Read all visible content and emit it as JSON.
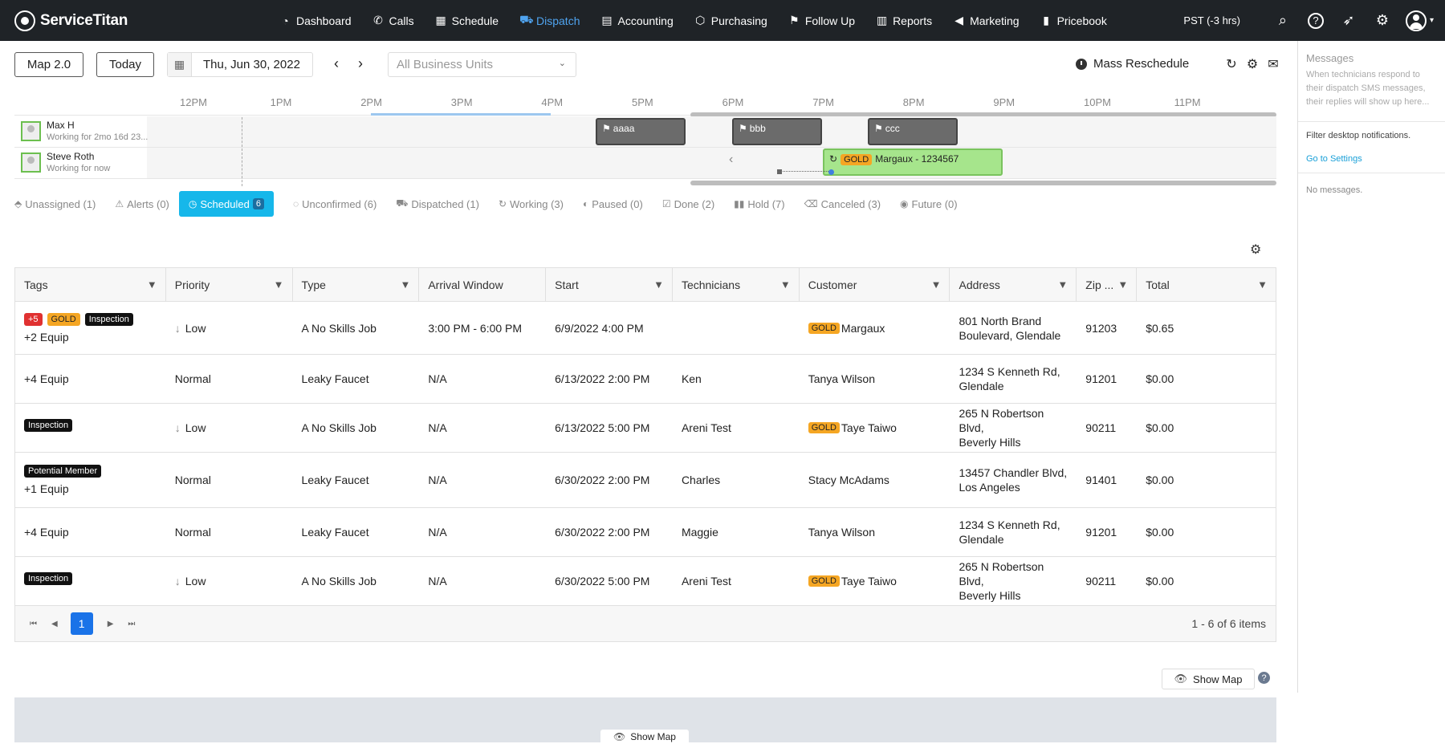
{
  "nav": {
    "brand": "ServiceTitan",
    "items": [
      {
        "label": "Dashboard",
        "icon": "dashboard-icon",
        "glyph": "◔",
        "active": false
      },
      {
        "label": "Calls",
        "icon": "phone-icon",
        "glyph": "✆",
        "active": false
      },
      {
        "label": "Schedule",
        "icon": "calendar-icon",
        "glyph": "▦",
        "active": false
      },
      {
        "label": "Dispatch",
        "icon": "truck-icon",
        "glyph": "⛟",
        "active": true
      },
      {
        "label": "Accounting",
        "icon": "clipboard-icon",
        "glyph": "▤",
        "active": false
      },
      {
        "label": "Purchasing",
        "icon": "box-icon",
        "glyph": "⬡",
        "active": false
      },
      {
        "label": "Follow Up",
        "icon": "flag-icon",
        "glyph": "⚑",
        "active": false
      },
      {
        "label": "Reports",
        "icon": "chart-icon",
        "glyph": "▥",
        "active": false
      },
      {
        "label": "Marketing",
        "icon": "megaphone-icon",
        "glyph": "◀",
        "active": false
      },
      {
        "label": "Pricebook",
        "icon": "book-icon",
        "glyph": "▮",
        "active": false
      }
    ],
    "timezone": "PST (-3 hrs)",
    "right_icons": {
      "search": "⌕",
      "help": "?",
      "rocket": "➶",
      "settings": "⚙",
      "caret": "▾"
    }
  },
  "toolbar": {
    "map_button": "Map 2.0",
    "today_button": "Today",
    "date": "Thu, Jun 30, 2022",
    "calendar_glyph": "▦",
    "prev_glyph": "‹",
    "next_glyph": "›",
    "business_units_placeholder": "All Business Units",
    "dropdown_glyph": "⌄",
    "mass_reschedule": "Mass Reschedule",
    "refresh_glyph": "↻",
    "gear_glyph": "⚙",
    "mail_glyph": "✉"
  },
  "timeline": {
    "hours": [
      "12PM",
      "1PM",
      "2PM",
      "3PM",
      "4PM",
      "5PM",
      "6PM",
      "7PM",
      "8PM",
      "9PM",
      "10PM",
      "11PM"
    ],
    "technicians": [
      {
        "name": "Max H",
        "status": "Working for 2mo 16d 23..."
      },
      {
        "name": "Steve Roth",
        "status": "Working for now"
      }
    ],
    "appointments": [
      {
        "tech": 0,
        "label": "aaaa",
        "flag": "⚑"
      },
      {
        "tech": 0,
        "label": "bbb",
        "flag": "⚑"
      },
      {
        "tech": 0,
        "label": "ccc",
        "flag": "⚑"
      },
      {
        "tech": 1,
        "label": "Margaux - 1234567",
        "badge": "GOLD",
        "glyph": "↻"
      }
    ],
    "lane_back_glyph": "‹"
  },
  "tabs": [
    {
      "label": "Unassigned (1)",
      "icon": "tag-icon",
      "glyph": "⬘"
    },
    {
      "label": "Alerts (0)",
      "icon": "warning-icon",
      "glyph": "⚠"
    },
    {
      "label": "Scheduled",
      "count": "6",
      "icon": "clock-icon",
      "glyph": "◷",
      "active": true
    },
    {
      "label": "Unconfirmed (6)",
      "icon": "check-circle-icon",
      "glyph": "◌"
    },
    {
      "label": "Dispatched (1)",
      "icon": "truck-icon",
      "glyph": "⛟"
    },
    {
      "label": "Working (3)",
      "icon": "refresh-icon",
      "glyph": "↻"
    },
    {
      "label": "Paused (0)",
      "icon": "half-circle-icon",
      "glyph": "◐"
    },
    {
      "label": "Done (2)",
      "icon": "checkbox-icon",
      "glyph": "☑"
    },
    {
      "label": "Hold (7)",
      "icon": "pause-icon",
      "glyph": "▮▮"
    },
    {
      "label": "Canceled (3)",
      "icon": "trash-icon",
      "glyph": "⌫"
    },
    {
      "label": "Future (0)",
      "icon": "eye-icon",
      "glyph": "◉"
    }
  ],
  "table": {
    "gear_glyph": "⚙",
    "filter_glyph": "▼",
    "columns": [
      "Tags",
      "Priority",
      "Type",
      "Arrival Window",
      "Start",
      "Technicians",
      "Customer",
      "Address",
      "Zip ...",
      "Total"
    ],
    "rows": [
      {
        "tags": [
          {
            "text": "+5",
            "kind": "red"
          },
          {
            "text": "GOLD",
            "kind": "gold"
          },
          {
            "text": "Inspection",
            "kind": "black"
          }
        ],
        "extra": "+2 Equip",
        "priority": "Low",
        "low": true,
        "type": "A No Skills Job",
        "arrival": "3:00 PM - 6:00 PM",
        "start": "6/9/2022 4:00 PM",
        "tech": "",
        "gold": true,
        "customer": "Margaux",
        "address1": "801 North Brand",
        "address2": "Boulevard, Glendale",
        "zip": "91203",
        "total": "$0.65"
      },
      {
        "tags": [],
        "extra": "+4 Equip",
        "priority": "Normal",
        "low": false,
        "type": "Leaky Faucet",
        "arrival": "N/A",
        "start": "6/13/2022 2:00 PM",
        "tech": "Ken",
        "gold": false,
        "customer": "Tanya Wilson",
        "address1": "1234 S Kenneth Rd,",
        "address2": "Glendale",
        "zip": "91201",
        "total": "$0.00"
      },
      {
        "tags": [
          {
            "text": "Inspection",
            "kind": "black"
          }
        ],
        "extra": "",
        "priority": "Low",
        "low": true,
        "type": "A No Skills Job",
        "arrival": "N/A",
        "start": "6/13/2022 5:00 PM",
        "tech": "Areni Test",
        "gold": true,
        "customer": "Taye Taiwo",
        "address1": "265 N Robertson Blvd,",
        "address2": "Beverly Hills",
        "zip": "90211",
        "total": "$0.00"
      },
      {
        "tags": [
          {
            "text": "Potential Member",
            "kind": "black"
          }
        ],
        "extra": "+1 Equip",
        "priority": "Normal",
        "low": false,
        "type": "Leaky Faucet",
        "arrival": "N/A",
        "start": "6/30/2022 2:00 PM",
        "tech": "Charles",
        "gold": false,
        "customer": "Stacy McAdams",
        "address1": "13457 Chandler Blvd,",
        "address2": "Los Angeles",
        "zip": "91401",
        "total": "$0.00"
      },
      {
        "tags": [],
        "extra": "+4 Equip",
        "priority": "Normal",
        "low": false,
        "type": "Leaky Faucet",
        "arrival": "N/A",
        "start": "6/30/2022 2:00 PM",
        "tech": "Maggie",
        "gold": false,
        "customer": "Tanya Wilson",
        "address1": "1234 S Kenneth Rd,",
        "address2": "Glendale",
        "zip": "91201",
        "total": "$0.00"
      },
      {
        "tags": [
          {
            "text": "Inspection",
            "kind": "black"
          }
        ],
        "extra": "",
        "priority": "Low",
        "low": true,
        "type": "A No Skills Job",
        "arrival": "N/A",
        "start": "6/30/2022 5:00 PM",
        "tech": "Areni Test",
        "gold": true,
        "customer": "Taye Taiwo",
        "address1": "265 N Robertson Blvd,",
        "address2": "Beverly Hills",
        "zip": "90211",
        "total": "$0.00"
      }
    ],
    "gold_label": "GOLD",
    "low_glyph": "↓"
  },
  "pager": {
    "first": "⏮",
    "prev": "◀",
    "current": "1",
    "next": "▶",
    "last": "⏭",
    "info": "1 - 6 of 6 items"
  },
  "map": {
    "show_map": "Show Map",
    "eye_glyph": "👁",
    "help": "?"
  },
  "messages": {
    "title": "Messages",
    "description": "When technicians respond to their dispatch SMS messages, their replies will show up here...",
    "notif": "Filter desktop notifications.",
    "settings_link": "Go to Settings",
    "none": "No messages."
  }
}
